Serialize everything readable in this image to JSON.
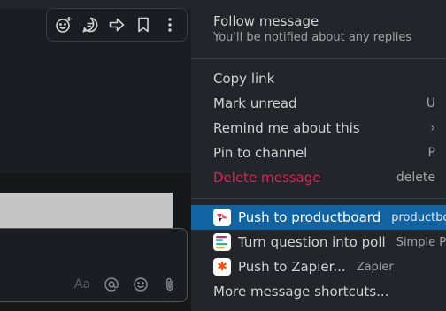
{
  "toolbar": {
    "icons": [
      "add-reaction-icon",
      "reply-in-thread-icon",
      "forward-icon",
      "bookmark-icon",
      "more-actions-icon"
    ]
  },
  "composer": {
    "format_label": "Aa",
    "icons": [
      "mention-icon",
      "emoji-icon",
      "attach-icon"
    ]
  },
  "menu": {
    "follow": {
      "title": "Follow message",
      "subtitle": "You'll be notified about any replies"
    },
    "items": [
      {
        "label": "Copy link",
        "shortcut": ""
      },
      {
        "label": "Mark unread",
        "shortcut": "U"
      },
      {
        "label": "Remind me about this",
        "shortcut": "›"
      },
      {
        "label": "Pin to channel",
        "shortcut": "P"
      },
      {
        "label": "Delete message",
        "shortcut": "delete"
      }
    ],
    "apps": [
      {
        "label": "Push to productboard",
        "app": "productboa...",
        "highlighted": true
      },
      {
        "label": "Turn question into poll",
        "app": "Simple Poll",
        "highlighted": false
      },
      {
        "label": "Push to Zapier...",
        "app": "Zapier",
        "highlighted": false
      }
    ],
    "more": "More message shortcuts..."
  },
  "colors": {
    "danger": "#e01e5a",
    "highlight": "#1164a3",
    "zapier": "#ff4a00"
  }
}
